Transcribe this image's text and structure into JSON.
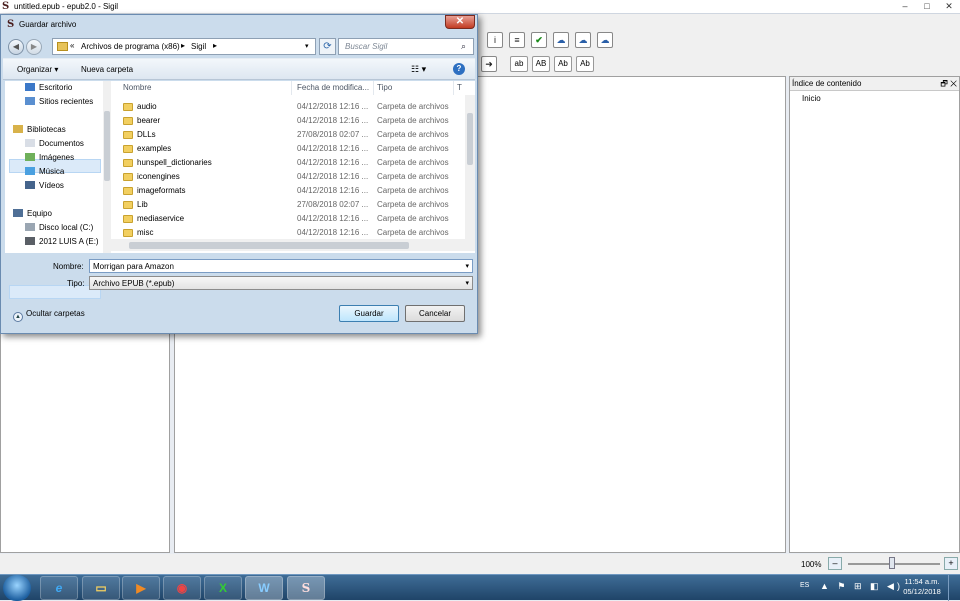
{
  "app": {
    "title": "untitled.epub - epub2.0 - Sigil",
    "logo": "S",
    "window_controls": [
      "–",
      "□",
      "✕"
    ],
    "toolbar_text_buttons": [
      "ab",
      "AB",
      "Ab",
      "Ab"
    ],
    "toc_title": "Índice de contenido",
    "toc_controls": "🗗 ✕",
    "toc_item": "Inicio",
    "zoom": "100%",
    "zoom_out": "–",
    "zoom_in": "+"
  },
  "dialog": {
    "title": "Guardar archivo",
    "logo": "S",
    "close": "✕",
    "back": "◀",
    "forward": "▶",
    "address_separator": "«",
    "breadcrumbs": [
      "Archivos de programa (x86)",
      "Sigil"
    ],
    "crumb_arrow": "▸",
    "dropdown_arrow": "▾",
    "refresh": "⟳",
    "search_placeholder": "Buscar Sigil",
    "search_icon": "⌕",
    "organize": "Organizar ▾",
    "new_folder": "Nueva carpeta",
    "view": "☷ ▾",
    "help": "?",
    "nav": [
      {
        "label": "Escritorio",
        "icon": "desktop-icon",
        "indent": 1
      },
      {
        "label": "Sitios recientes",
        "icon": "recent-places-icon",
        "indent": 1
      },
      {
        "label": "Bibliotecas",
        "icon": "libraries-icon",
        "indent": 0
      },
      {
        "label": "Documentos",
        "icon": "documents-icon",
        "indent": 1
      },
      {
        "label": "Imágenes",
        "icon": "pictures-icon",
        "indent": 1
      },
      {
        "label": "Música",
        "icon": "music-icon",
        "indent": 1
      },
      {
        "label": "Vídeos",
        "icon": "videos-icon",
        "indent": 1
      },
      {
        "label": "Equipo",
        "icon": "computer-icon",
        "indent": 0
      },
      {
        "label": "Disco local (C:)",
        "icon": "drive-icon",
        "indent": 1
      },
      {
        "label": "2012 LUIS A (E:)",
        "icon": "removable-drive-icon",
        "indent": 1
      }
    ],
    "columns": [
      "Nombre",
      "Fecha de modifica...",
      "Tipo",
      "T"
    ],
    "files": [
      {
        "name": "audio",
        "date": "04/12/2018 12:16 ...",
        "type": "Carpeta de archivos"
      },
      {
        "name": "bearer",
        "date": "04/12/2018 12:16 ...",
        "type": "Carpeta de archivos"
      },
      {
        "name": "DLLs",
        "date": "27/08/2018 02:07 ...",
        "type": "Carpeta de archivos"
      },
      {
        "name": "examples",
        "date": "04/12/2018 12:16 ...",
        "type": "Carpeta de archivos"
      },
      {
        "name": "hunspell_dictionaries",
        "date": "04/12/2018 12:16 ...",
        "type": "Carpeta de archivos"
      },
      {
        "name": "iconengines",
        "date": "04/12/2018 12:16 ...",
        "type": "Carpeta de archivos"
      },
      {
        "name": "imageformats",
        "date": "04/12/2018 12:16 ...",
        "type": "Carpeta de archivos"
      },
      {
        "name": "Lib",
        "date": "27/08/2018 02:07 ...",
        "type": "Carpeta de archivos"
      },
      {
        "name": "mediaservice",
        "date": "04/12/2018 12:16 ...",
        "type": "Carpeta de archivos"
      },
      {
        "name": "misc",
        "date": "04/12/2018 12:16 ...",
        "type": "Carpeta de archivos"
      }
    ],
    "name_label": "Nombre:",
    "name_value": "Morrigan para Amazon",
    "type_label": "Tipo:",
    "type_value": "Archivo EPUB (*.epub)",
    "hide_folders": "Ocultar carpetas",
    "hide_icon": "▲",
    "save": "Guardar",
    "cancel": "Cancelar"
  },
  "taskbar": {
    "apps": [
      "Internet Explorer",
      "Explorador de Windows",
      "Reproductor",
      "Google Chrome",
      "Excel",
      "Word",
      "Sigil"
    ],
    "app_glyphs": [
      "e",
      "▭",
      "▶",
      "◉",
      "X",
      "W",
      "S"
    ],
    "language": "ES",
    "tray": "▲ ⚑ ⊞ ◧ ◀)",
    "time": "11:54 a.m.",
    "date": "05/12/2018"
  }
}
